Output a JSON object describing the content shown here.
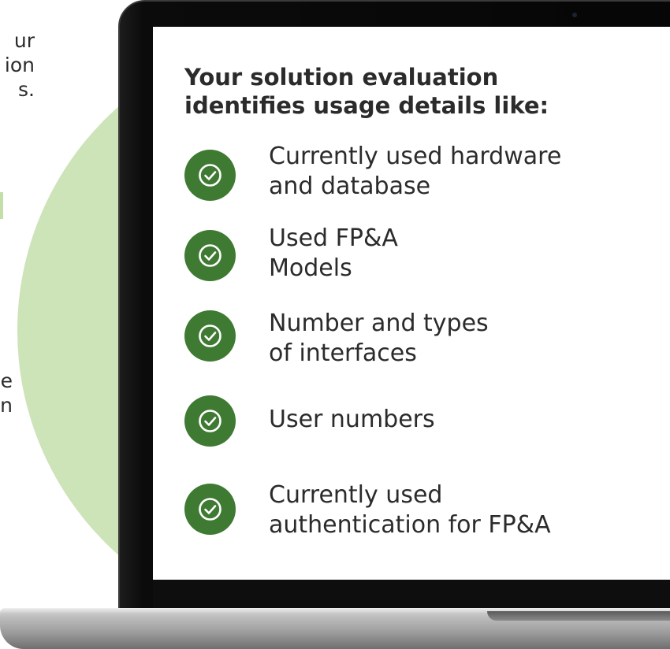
{
  "left_panel": {
    "top_fragment_lines": [
      "ur",
      "ion",
      "s."
    ],
    "bottom_fragment_lines": [
      "e",
      "n"
    ]
  },
  "screen": {
    "heading_lines": [
      "Your solution evaluation",
      "identifies usage details like:"
    ],
    "items": [
      {
        "icon": "check-circle-icon",
        "lines": [
          "Currently used hardware",
          "and database"
        ]
      },
      {
        "icon": "check-circle-icon",
        "lines": [
          "Used FP&A",
          "Models"
        ]
      },
      {
        "icon": "check-circle-icon",
        "lines": [
          "Number and types",
          "of interfaces"
        ]
      },
      {
        "icon": "check-circle-icon",
        "lines": [
          "User numbers"
        ]
      },
      {
        "icon": "check-circle-icon",
        "lines": [
          "Currently used",
          "authentication for FP&A"
        ]
      }
    ]
  },
  "colors": {
    "accent_green": "#3f7a33",
    "backdrop_green": "#cde3b8",
    "text": "#2b2b2b"
  }
}
